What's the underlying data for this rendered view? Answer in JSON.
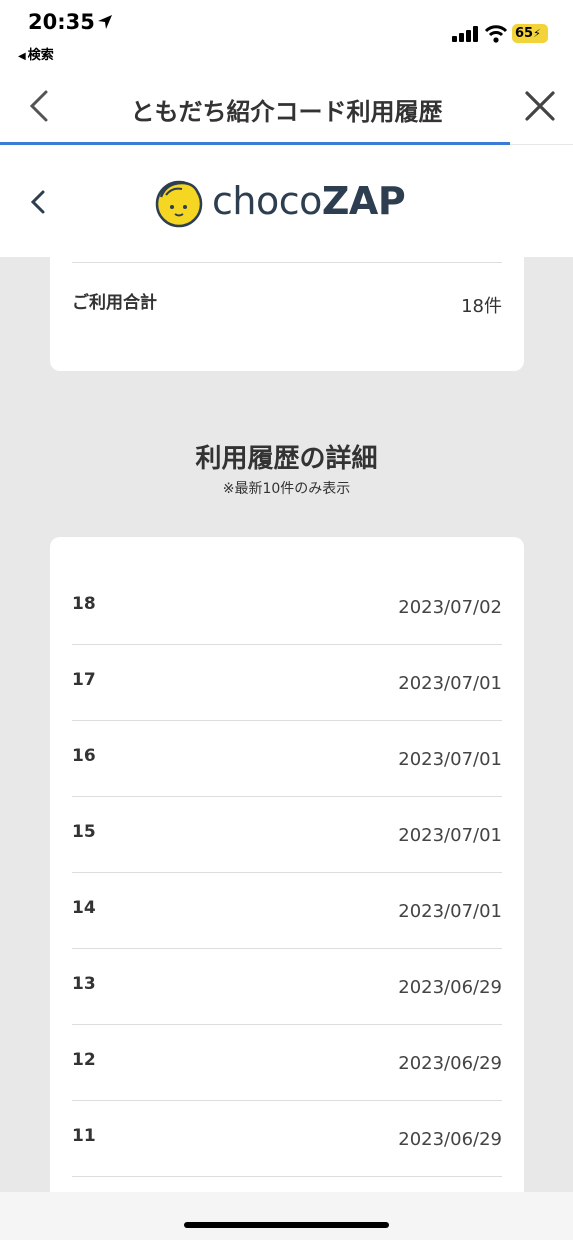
{
  "status": {
    "time": "20:35",
    "back_app": "検索",
    "battery": "65"
  },
  "nav": {
    "title": "ともだち紹介コード利用履歴"
  },
  "app": {
    "logo_prefix": "choco",
    "logo_suffix": "ZAP"
  },
  "summary": {
    "label": "ご利用合計",
    "value": "18件"
  },
  "history": {
    "title": "利用履歴の詳細",
    "note": "※最新10件のみ表示",
    "rows": [
      {
        "num": "18",
        "date": "2023/07/02"
      },
      {
        "num": "17",
        "date": "2023/07/01"
      },
      {
        "num": "16",
        "date": "2023/07/01"
      },
      {
        "num": "15",
        "date": "2023/07/01"
      },
      {
        "num": "14",
        "date": "2023/07/01"
      },
      {
        "num": "13",
        "date": "2023/06/29"
      },
      {
        "num": "12",
        "date": "2023/06/29"
      },
      {
        "num": "11",
        "date": "2023/06/29"
      }
    ]
  },
  "colors": {
    "accent": "#3a7bd5",
    "logo_yellow": "#f5d623",
    "logo_text": "#2d3e50"
  },
  "icons": {
    "location": "location-arrow-icon",
    "signal": "cellular-signal-icon",
    "wifi": "wifi-icon",
    "battery": "battery-charging-icon",
    "back": "chevron-left-icon",
    "close": "close-icon"
  }
}
